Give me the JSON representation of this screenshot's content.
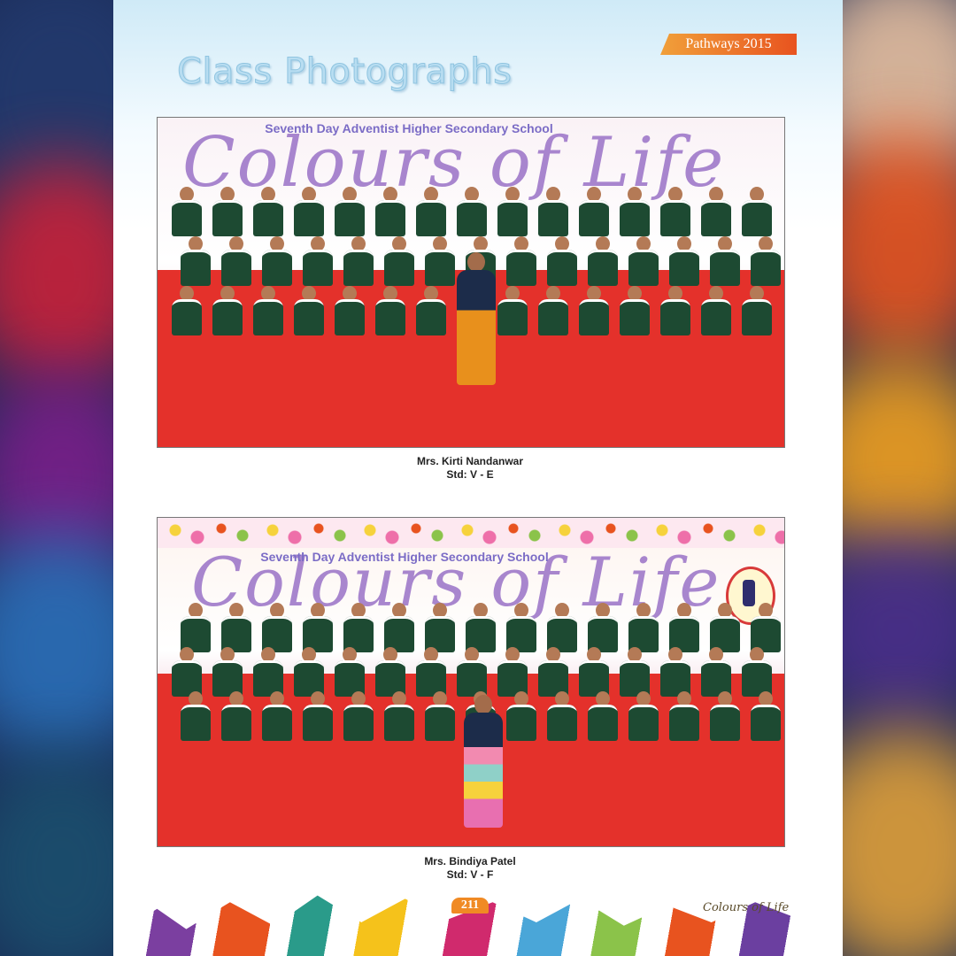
{
  "header": {
    "tag": "Pathways 2015"
  },
  "title": "Class Photographs",
  "photos": [
    {
      "school": "Seventh Day Adventist Higher Secondary School",
      "banner": "Colours of Life",
      "teacher": "Mrs. Kirti Nandanwar",
      "std": "Std: V - E"
    },
    {
      "school": "Seventh Day Adventist Higher Secondary School",
      "banner": "Colours of Life",
      "teacher": "Mrs. Bindiya Patel",
      "std": "Std: V - F"
    }
  ],
  "footer": {
    "page_number": "211",
    "brand": "Colours of Life"
  },
  "colors": {
    "title": "#b8ddf1",
    "tag": "#e8531f",
    "stage": "#e4312b",
    "uniform": "#1d4a32",
    "banner_text": "#9a72c7"
  }
}
